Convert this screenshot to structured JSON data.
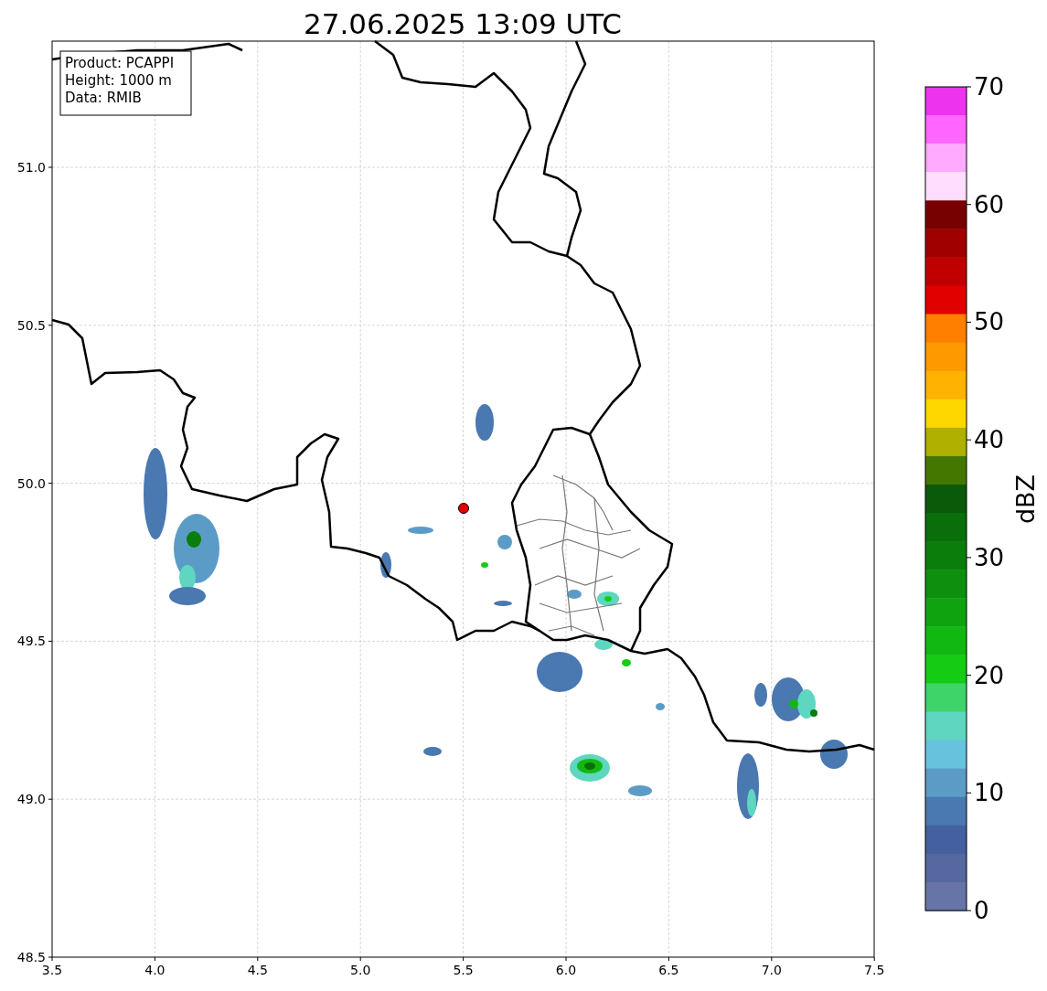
{
  "title": "27.06.2025 13:09 UTC",
  "info_box": {
    "lines": [
      "Product: PCAPPI",
      "Height: 1000 m",
      "Data: RMIB"
    ]
  },
  "map": {
    "yticks": [
      "51.0",
      "50.5",
      "50.0",
      "49.5",
      "49.0",
      "48.5"
    ],
    "xticks": [
      "3.5",
      "4.0",
      "4.5",
      "5.0",
      "5.5",
      "6.0",
      "6.5",
      "7.0",
      "7.5"
    ]
  },
  "colorbar": {
    "label": "dBZ",
    "ticks": [
      "70",
      "60",
      "50",
      "40",
      "30",
      "20",
      "10",
      "0"
    ],
    "bands": [
      {
        "color": "#ee33ee"
      },
      {
        "color": "#ff66ff"
      },
      {
        "color": "#ffaaff"
      },
      {
        "color": "#ffddff"
      },
      {
        "color": "#770000"
      },
      {
        "color": "#a00000"
      },
      {
        "color": "#c00000"
      },
      {
        "color": "#e00000"
      },
      {
        "color": "#ff7f00"
      },
      {
        "color": "#ff9900"
      },
      {
        "color": "#ffb300"
      },
      {
        "color": "#ffd700"
      },
      {
        "color": "#b0b000"
      },
      {
        "color": "#447700"
      },
      {
        "color": "#0a5a0a"
      },
      {
        "color": "#0a6e0a"
      },
      {
        "color": "#0b7d0b"
      },
      {
        "color": "#0e8f0e"
      },
      {
        "color": "#10a310"
      },
      {
        "color": "#12b812"
      },
      {
        "color": "#14cc14"
      },
      {
        "color": "#3ed46a"
      },
      {
        "color": "#5fd6c0"
      },
      {
        "color": "#66c2dd"
      },
      {
        "color": "#5b9cc7"
      },
      {
        "color": "#4a78b0"
      },
      {
        "color": "#4460a0"
      },
      {
        "color": "#5668a0"
      },
      {
        "color": "#6674a8"
      }
    ]
  }
}
